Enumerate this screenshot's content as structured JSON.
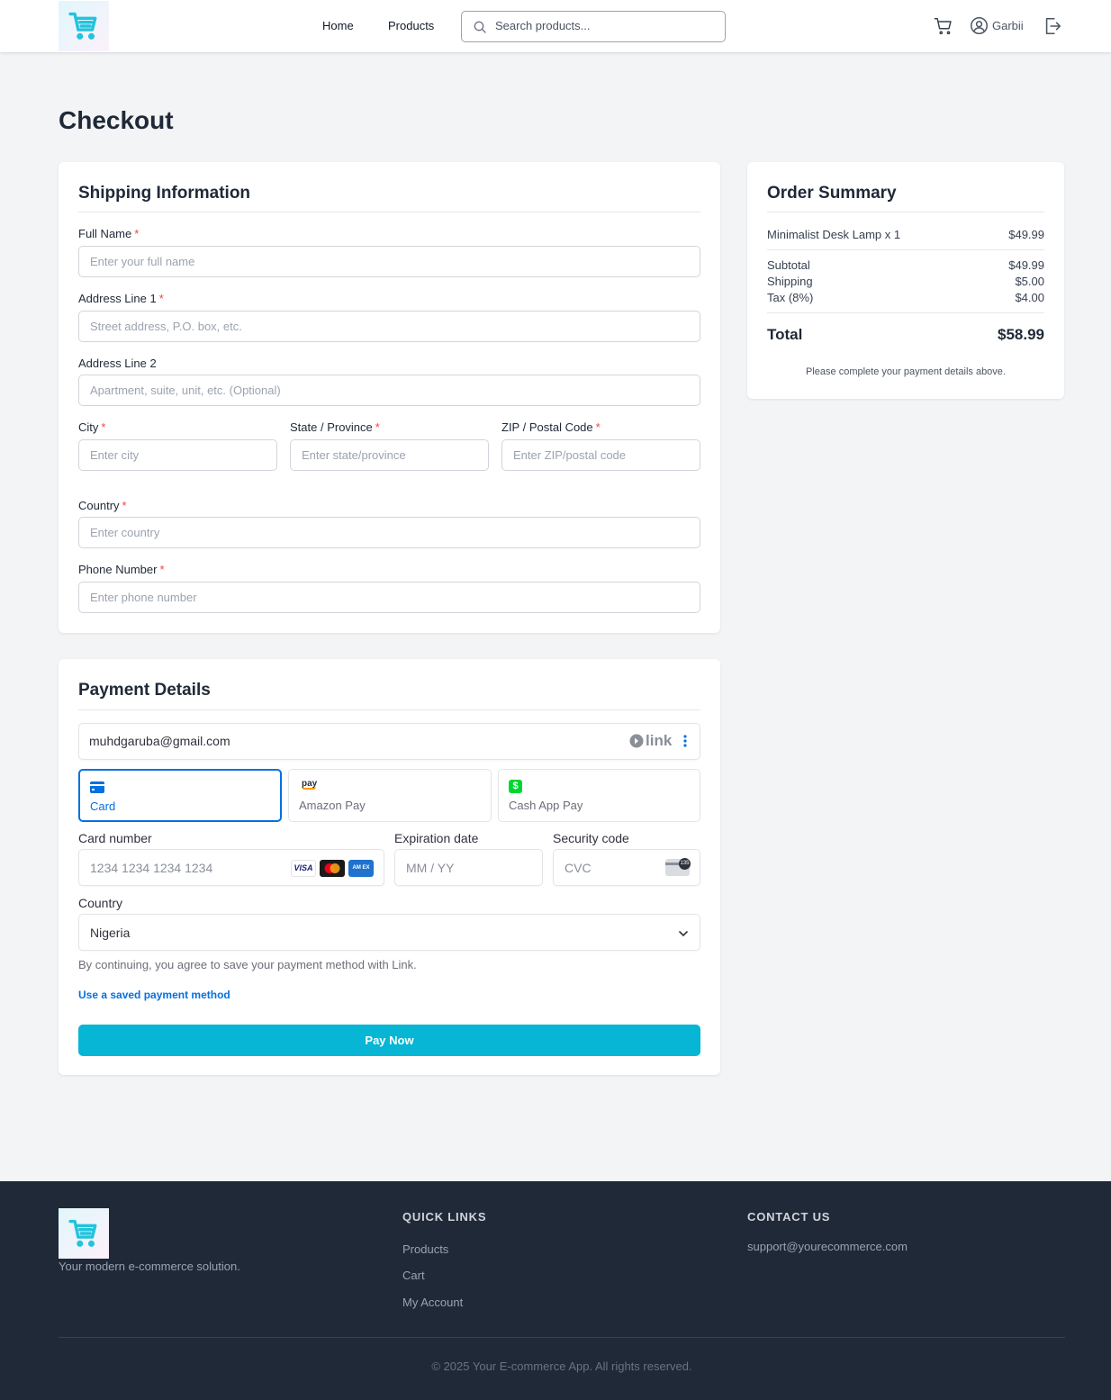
{
  "header": {
    "nav": {
      "home": "Home",
      "products": "Products"
    },
    "search_placeholder": "Search products...",
    "username": "Garbii"
  },
  "page_title": "Checkout",
  "shipping": {
    "title": "Shipping Information",
    "full_name": {
      "label": "Full Name",
      "placeholder": "Enter your full name"
    },
    "address1": {
      "label": "Address Line 1",
      "placeholder": "Street address, P.O. box, etc."
    },
    "address2": {
      "label": "Address Line 2",
      "placeholder": "Apartment, suite, unit, etc. (Optional)"
    },
    "city": {
      "label": "City",
      "placeholder": "Enter city"
    },
    "state": {
      "label": "State / Province",
      "placeholder": "Enter state/province"
    },
    "zip": {
      "label": "ZIP / Postal Code",
      "placeholder": "Enter ZIP/postal code"
    },
    "country": {
      "label": "Country",
      "placeholder": "Enter country"
    },
    "phone": {
      "label": "Phone Number",
      "placeholder": "Enter phone number"
    },
    "required_mark": "*"
  },
  "payment": {
    "title": "Payment Details",
    "email": "muhdgaruba@gmail.com",
    "link_label": "link",
    "methods": [
      {
        "label": "Card",
        "icon": "card-icon",
        "selected": true
      },
      {
        "label": "Amazon Pay",
        "icon": "amazon-pay-icon",
        "selected": false
      },
      {
        "label": "Cash App Pay",
        "icon": "cash-app-icon",
        "selected": false
      }
    ],
    "card_number": {
      "label": "Card number",
      "placeholder": "1234 1234 1234 1234"
    },
    "expiration": {
      "label": "Expiration date",
      "placeholder": "MM / YY"
    },
    "security": {
      "label": "Security code",
      "placeholder": "CVC"
    },
    "country": {
      "label": "Country",
      "value": "Nigeria"
    },
    "terms": "By continuing, you agree to save your payment method with Link.",
    "saved_method_link": "Use a saved payment method",
    "pay_button": "Pay Now",
    "card_brands": [
      "VISA",
      "Mastercard",
      "AMEX"
    ],
    "amazon_pay_logo_text": "pay",
    "cash_app_logo_text": "$",
    "cvc_icon_text": "135"
  },
  "summary": {
    "title": "Order Summary",
    "item": {
      "name": "Minimalist Desk Lamp x 1",
      "price": "$49.99"
    },
    "subtotal": {
      "label": "Subtotal",
      "value": "$49.99"
    },
    "shipping": {
      "label": "Shipping",
      "value": "$5.00"
    },
    "tax": {
      "label": "Tax (8%)",
      "value": "$4.00"
    },
    "total": {
      "label": "Total",
      "value": "$58.99"
    },
    "note": "Please complete your payment details above."
  },
  "footer": {
    "tagline": "Your modern e-commerce solution.",
    "quick_links_title": "QUICK LINKS",
    "quick_links": [
      "Products",
      "Cart",
      "My Account"
    ],
    "contact_title": "CONTACT US",
    "email": "support@yourecommerce.com",
    "copyright": "© 2025 Your E-commerce App. All rights reserved."
  },
  "colors": {
    "accent": "#06b6d4",
    "stripe_blue": "#0570de",
    "footer_bg": "#1f2937",
    "required": "#ef4444"
  }
}
